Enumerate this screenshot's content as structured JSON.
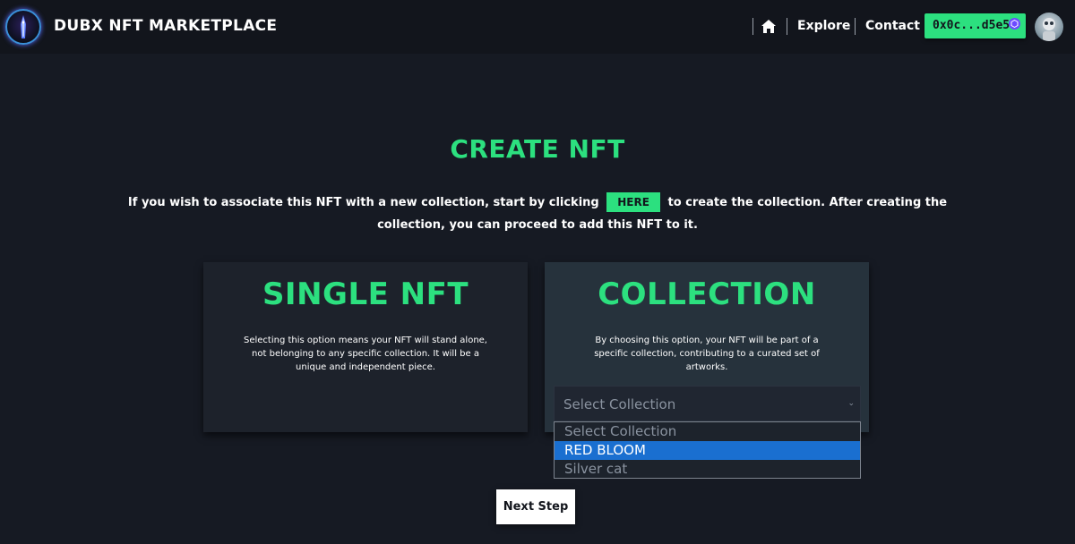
{
  "header": {
    "brand": "DUBX NFT MARKETPLACE",
    "nav": {
      "home_icon": "home-icon",
      "explore": "Explore",
      "contact": "Contact"
    },
    "wallet": "0x0c...d5e5"
  },
  "main": {
    "title": "CREATE NFT",
    "intro_before": "If you wish to associate this NFT with a new collection, start by clicking",
    "here_label": "HERE",
    "intro_after": "to create the collection. After creating the collection, you can proceed to add this NFT to it."
  },
  "cards": {
    "single": {
      "title": "SINGLE NFT",
      "description": "Selecting this option means your NFT will stand alone, not belonging to any specific collection. It will be a unique and independent piece."
    },
    "collection": {
      "title": "COLLECTION",
      "description": "By choosing this option, your NFT will be part of a specific collection, contributing to a curated set of artworks.",
      "select_value": "Select Collection",
      "options": [
        "Select Collection",
        "RED BLOOM",
        "Silver cat"
      ],
      "highlighted_option": "RED BLOOM"
    }
  },
  "footer": {
    "next_label": "Next Step"
  },
  "colors": {
    "accent": "#2ce07f",
    "background": "#161a23",
    "highlight": "#1a6fd0"
  }
}
